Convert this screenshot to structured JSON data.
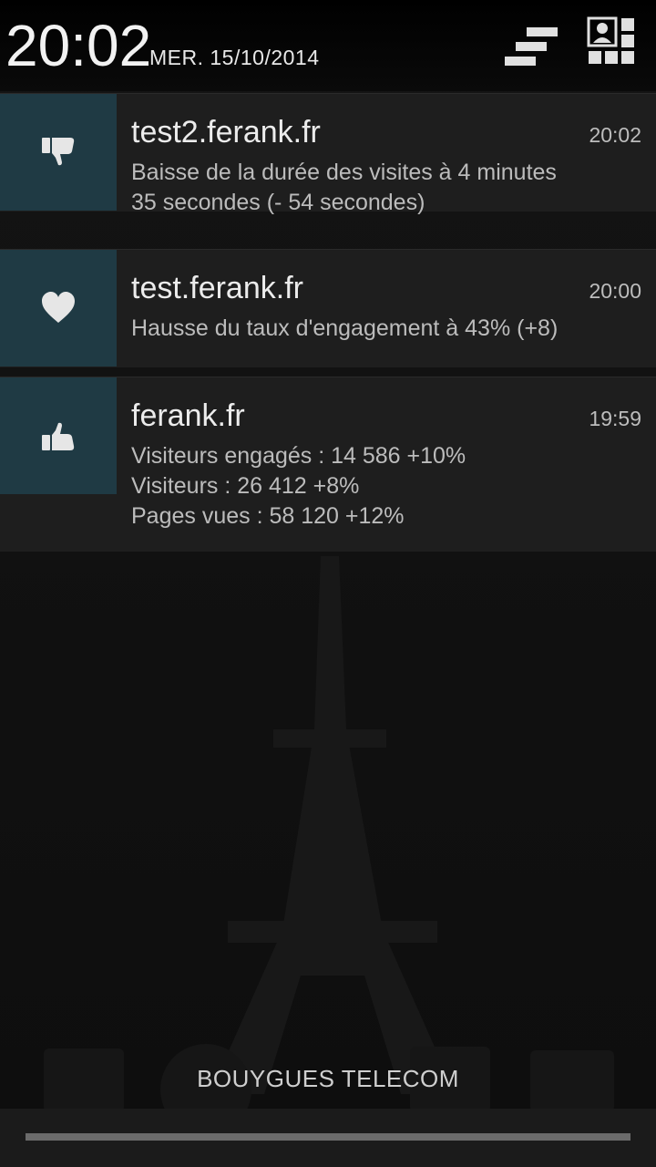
{
  "status": {
    "time": "20:02",
    "date": "MER. 15/10/2014"
  },
  "icons": {
    "clear": "clear-all-icon",
    "settings": "quick-settings-icon"
  },
  "notifications": [
    {
      "icon": "thumbs-down-icon",
      "title": "test2.ferank.fr",
      "time": "20:02",
      "lines": [
        "Baisse de la durée des visites à 4 minutes",
        "35 secondes (- 54 secondes)"
      ]
    },
    {
      "icon": "heart-icon",
      "title": "test.ferank.fr",
      "time": "20:00",
      "lines": [
        "Hausse du taux d'engagement à 43% (+8)"
      ]
    },
    {
      "icon": "thumbs-up-icon",
      "title": "ferank.fr",
      "time": "19:59",
      "lines": [
        "Visiteurs engagés : 14 586 +10%",
        "Visiteurs : 26 412 +8%",
        "Pages vues : 58 120 +12%"
      ]
    }
  ],
  "carrier": "BOUYGUES TELECOM",
  "colors": {
    "icon_background": "#1f3a44",
    "notification_background": "#1e1e1e"
  }
}
